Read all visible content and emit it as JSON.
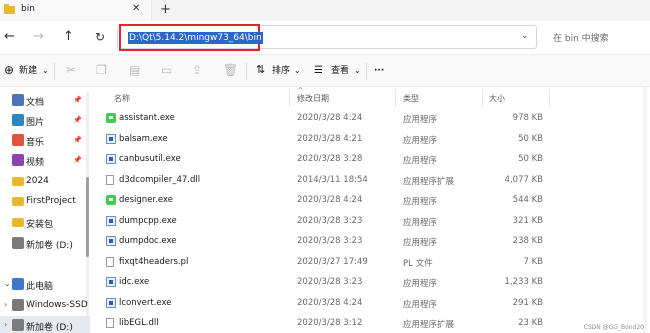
{
  "tab": {
    "title": "bin",
    "close": "✕",
    "new_tab": "+"
  },
  "nav": {
    "back": "←",
    "forward": "→",
    "up": "↑",
    "refresh": "↻"
  },
  "address": {
    "path": "D:\\Qt\\5.14.2\\mingw73_64\\bin",
    "dropdown": "⌄"
  },
  "search": {
    "placeholder": "在 bin 中搜索"
  },
  "commands": {
    "new_label": "新建",
    "sort_label": "排序",
    "view_label": "查看",
    "more": "···",
    "caret": "⌄"
  },
  "sidebar": {
    "items": [
      {
        "label": "文档",
        "pinned": true,
        "color": "#4b72b8"
      },
      {
        "label": "图片",
        "pinned": true,
        "color": "#2e86c1"
      },
      {
        "label": "音乐",
        "pinned": true,
        "color": "#e0533d"
      },
      {
        "label": "视频",
        "pinned": true,
        "color": "#8e44ad"
      },
      {
        "label": "2024",
        "pinned": false,
        "color": "#e8b830"
      },
      {
        "label": "FirstProject",
        "pinned": false,
        "color": "#e8b830"
      },
      {
        "label": "安装包",
        "pinned": false,
        "color": "#e8b830"
      },
      {
        "label": "新加卷 (D:)",
        "pinned": false,
        "color": "#7a7a7a"
      },
      {
        "label": "此电脑",
        "pinned": false,
        "color": "#3f78c6"
      },
      {
        "label": "Windows-SSD",
        "pinned": false,
        "color": "#7a7a7a"
      },
      {
        "label": "新加卷 (D:)",
        "pinned": false,
        "color": "#7a7a7a"
      }
    ]
  },
  "columns": {
    "name": "名称",
    "date": "修改日期",
    "type": "类型",
    "size": "大小",
    "sort_caret": "^"
  },
  "files": [
    {
      "name": "assistant.exe",
      "date": "2020/3/28 4:24",
      "type": "应用程序",
      "size": "978 KB",
      "icon": "qt-icon"
    },
    {
      "name": "balsam.exe",
      "date": "2020/3/28 4:21",
      "type": "应用程序",
      "size": "50 KB",
      "icon": "exe-icon"
    },
    {
      "name": "canbusutil.exe",
      "date": "2020/3/28 3:28",
      "type": "应用程序",
      "size": "50 KB",
      "icon": "exe-icon"
    },
    {
      "name": "d3dcompiler_47.dll",
      "date": "2014/3/11 18:54",
      "type": "应用程序扩展",
      "size": "4,077 KB",
      "icon": "doc-icon"
    },
    {
      "name": "designer.exe",
      "date": "2020/3/28 4:24",
      "type": "应用程序",
      "size": "544 KB",
      "icon": "qt-icon"
    },
    {
      "name": "dumpcpp.exe",
      "date": "2020/3/28 3:23",
      "type": "应用程序",
      "size": "321 KB",
      "icon": "exe-icon"
    },
    {
      "name": "dumpdoc.exe",
      "date": "2020/3/28 3:23",
      "type": "应用程序",
      "size": "238 KB",
      "icon": "exe-icon"
    },
    {
      "name": "fixqt4headers.pl",
      "date": "2020/3/27 17:49",
      "type": "PL 文件",
      "size": "7 KB",
      "icon": "doc-icon"
    },
    {
      "name": "idc.exe",
      "date": "2020/3/28 3:23",
      "type": "应用程序",
      "size": "1,233 KB",
      "icon": "exe-icon"
    },
    {
      "name": "lconvert.exe",
      "date": "2020/3/28 4:24",
      "type": "应用程序",
      "size": "291 KB",
      "icon": "exe-icon"
    },
    {
      "name": "libEGL.dll",
      "date": "2020/3/28 3:12",
      "type": "应用程序扩展",
      "size": "23 KB",
      "icon": "doc-icon"
    }
  ],
  "watermark": "CSDN @GG_Bond20",
  "colors": {
    "accent_highlight": "#2b66c8",
    "annotation_red": "#e0242c"
  }
}
